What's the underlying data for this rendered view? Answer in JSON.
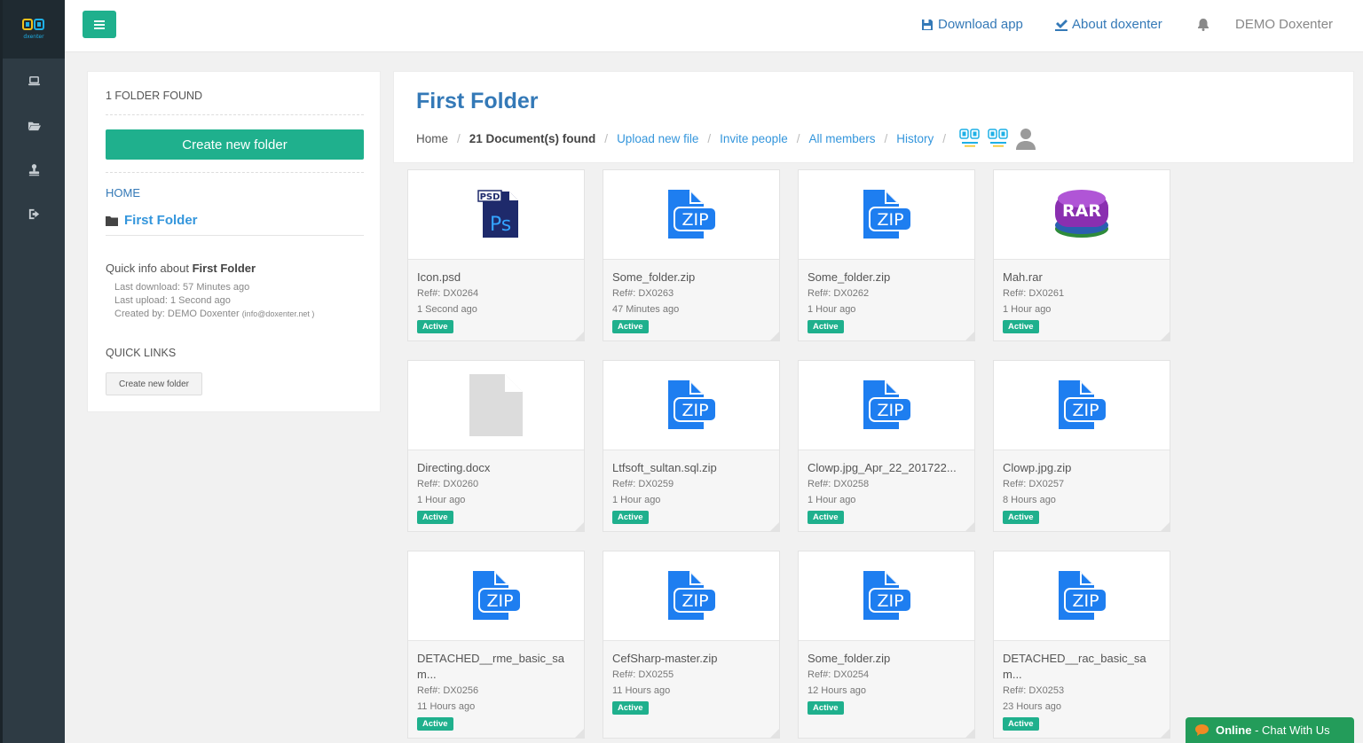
{
  "app": {
    "logo_text": "dxenter",
    "menu_label": "Menu"
  },
  "topbar": {
    "download_app": "Download app",
    "about": "About doxenter",
    "user": "DEMO Doxenter"
  },
  "sidebar": {
    "count": "1 FOLDER FOUND",
    "create_button": "Create new folder",
    "home": "HOME",
    "folder": "First Folder",
    "quick_info_prefix": "Quick info about ",
    "quick_info_folder": "First Folder",
    "last_download": "Last download: 57 Minutes ago",
    "last_upload": "Last upload: 1 Second ago",
    "created_by": "Created by: DEMO Doxenter",
    "created_email": "(info@doxenter.net )",
    "quick_links_title": "QUICK LINKS",
    "quick_links_button": "Create new folder"
  },
  "header": {
    "title": "First Folder",
    "crumbs": {
      "home": "Home",
      "docs_found": "21 Document(s) found",
      "upload": "Upload new file",
      "invite": "Invite people",
      "members": "All members",
      "history": "History"
    }
  },
  "files": [
    {
      "name": "Icon.psd",
      "ref": "Ref#: DX0264",
      "time": "1 Second ago",
      "status": "Active",
      "icon": "psd"
    },
    {
      "name": "Some_folder.zip",
      "ref": "Ref#: DX0263",
      "time": "47 Minutes ago",
      "status": "Active",
      "icon": "zip"
    },
    {
      "name": "Some_folder.zip",
      "ref": "Ref#: DX0262",
      "time": "1 Hour ago",
      "status": "Active",
      "icon": "zip"
    },
    {
      "name": "Mah.rar",
      "ref": "Ref#: DX0261",
      "time": "1 Hour ago",
      "status": "Active",
      "icon": "rar"
    },
    {
      "name": "Directing.docx",
      "ref": "Ref#: DX0260",
      "time": "1 Hour ago",
      "status": "Active",
      "icon": "doc"
    },
    {
      "name": "Ltfsoft_sultan.sql.zip",
      "ref": "Ref#: DX0259",
      "time": "1 Hour ago",
      "status": "Active",
      "icon": "zip"
    },
    {
      "name": "Clowp.jpg_Apr_22_201722...",
      "ref": "Ref#: DX0258",
      "time": "1 Hour ago",
      "status": "Active",
      "icon": "zip"
    },
    {
      "name": "Clowp.jpg.zip",
      "ref": "Ref#: DX0257",
      "time": "8 Hours ago",
      "status": "Active",
      "icon": "zip"
    },
    {
      "name": "DETACHED__rme_basic_sam...",
      "ref": "Ref#: DX0256",
      "time": "11 Hours ago",
      "status": "Active",
      "icon": "zip"
    },
    {
      "name": "CefSharp-master.zip",
      "ref": "Ref#: DX0255",
      "time": "11 Hours ago",
      "status": "Active",
      "icon": "zip"
    },
    {
      "name": "Some_folder.zip",
      "ref": "Ref#: DX0254",
      "time": "12 Hours ago",
      "status": "Active",
      "icon": "zip"
    },
    {
      "name": "DETACHED__rac_basic_sam...",
      "ref": "Ref#: DX0253",
      "time": "23 Hours ago",
      "status": "Active",
      "icon": "zip"
    }
  ],
  "chat": {
    "status": "Online",
    "label": " - Chat With Us"
  },
  "colors": {
    "accent": "#1fb08d",
    "link": "#3479b7",
    "rail": "#2e3b44",
    "zip": "#1e7ef0"
  }
}
